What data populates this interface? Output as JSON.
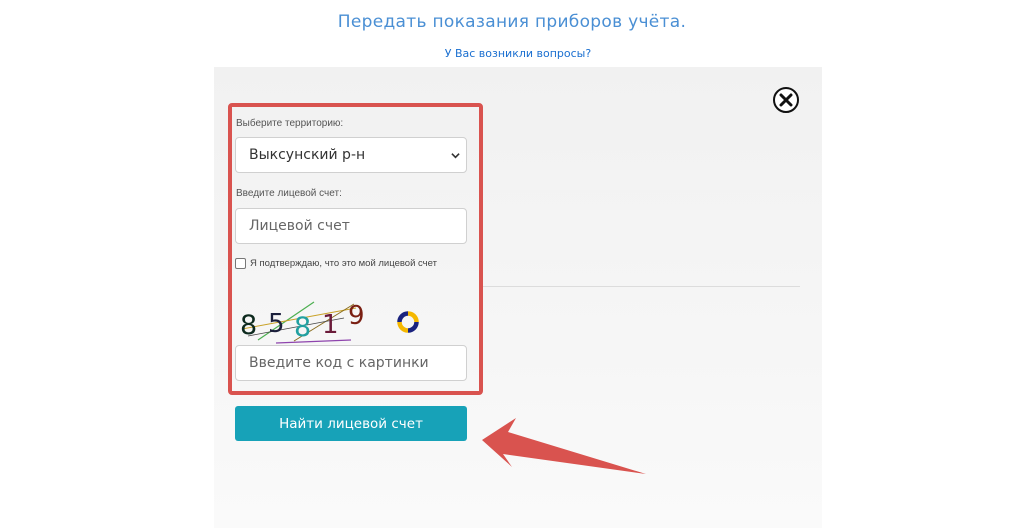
{
  "header": {
    "title": "Передать показания приборов учёта.",
    "help_link": "У Вас возникли вопросы?"
  },
  "form": {
    "territory_label": "Выберите территорию:",
    "territory_value": "Выксунский р-н",
    "account_label": "Введите лицевой счет:",
    "account_placeholder": "Лицевой счет",
    "confirm_label": "Я подтверждаю, что это мой лицевой счет",
    "confirm_checked": false,
    "captcha_digits": [
      "8",
      "5",
      "8",
      "1",
      "9"
    ],
    "captcha_placeholder": "Введите код с картинки",
    "submit_label": "Найти лицевой счет"
  },
  "icons": {
    "close": "close-icon",
    "refresh": "refresh-icon",
    "dropdown": "chevron-down-icon"
  },
  "colors": {
    "title": "#4a8fd4",
    "link": "#1a6fd0",
    "button": "#17a2b8",
    "highlight": "#d9534f",
    "annotation_arrow": "#d9534f",
    "refresh_icon": "#f5b800"
  }
}
